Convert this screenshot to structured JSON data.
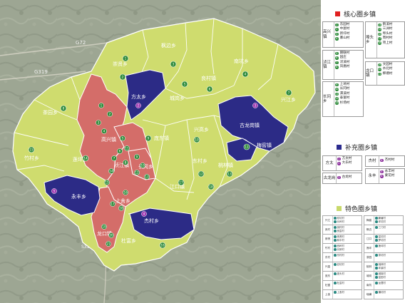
{
  "road_labels": {
    "g72": "G72",
    "g319": "G319",
    "bottom": "S311"
  },
  "regions": {
    "fengbian": "枫边乡",
    "chongxian": "崇贤乡",
    "nankeng": "南坑乡",
    "langcun": "良村镇",
    "xingjiang": "兴江乡",
    "fangtai": "方太乡",
    "chengan": "城岗乡",
    "chaka": "茶园乡",
    "zhucun": "竹村乡",
    "gulonggang": "古龙岗镇",
    "xingao": "兴高乡",
    "pangdong": "庞东镇",
    "meijiao": "梅窖镇",
    "dongcun": "东村乡",
    "xianlian": "莲坪乡",
    "changgang": "长冈乡",
    "taolin": "桃林镇",
    "gaoxing": "高兴镇",
    "shangshe": "上舍乡",
    "yongfeng": "永丰乡",
    "jiangkou": "江口镇",
    "jiangbei": "浈江镇",
    "longkou": "龙口镇",
    "dusan": "杜富乡",
    "jiecun": "杰村乡",
    "ruiheng": "瑞横乡"
  },
  "numbers": {
    "n1": "1",
    "n2": "2",
    "n3": "3",
    "n4": "4",
    "n5": "5",
    "n6": "6",
    "n7": "7",
    "n8": "8",
    "n9": "9",
    "n10": "10",
    "n11": "11",
    "n12": "12",
    "n13": "13",
    "n14": "14",
    "n15": "15",
    "n16": "16",
    "n17": "17",
    "n18": "18",
    "n19": "19",
    "n20": "20",
    "n21": "21"
  },
  "legend": {
    "core_title": "核心圈乡镇",
    "core_color": "#e02020",
    "supp_title": "补充圈乡镇",
    "supp_color": "#2b2b8e",
    "feature_title": "特色圈乡镇",
    "feature_color": "#c8d96b",
    "core_groups": [
      {
        "name": "高兴镇",
        "items": [
          "1 东园村",
          "2 中屋村",
          "3 新圩村",
          "4 寨山村"
        ]
      },
      {
        "name": "浈江镇",
        "items": [
          "5 赣联村",
          "6 园庄",
          "7 浈溪村",
          "8 凤凰村"
        ]
      },
      {
        "name": "长冈乡",
        "items": [
          "9 上坑村",
          "10 长冈村",
          "11 泗溪村",
          "12 泰富村",
          "13 杉场村"
        ]
      },
      {
        "name": "埠头乡",
        "items": [
          "14 鹤溪村",
          "15 三洲村",
          "16 埠头村",
          "17 周村村",
          "18 项上村"
        ]
      },
      {
        "name": "龙口镇",
        "items": [
          "19 文园村",
          "20 水北村",
          "21 柳塘村"
        ]
      }
    ],
    "supp_groups": [
      {
        "name": "方太",
        "items": [
          "方太村",
          "大乐村"
        ]
      },
      {
        "name": "杰村",
        "items": [
          "杰村村"
        ]
      },
      {
        "name": "古龙岗",
        "items": [
          "古龙村"
        ]
      },
      {
        "name": "永丰",
        "items": [
          "永丰村",
          "蒙花村"
        ]
      }
    ],
    "feature_cells": [
      {
        "n": "兴江",
        "v": [
          "双坑村",
          "长岭村"
        ]
      },
      {
        "n": "梅窖",
        "v": [
          "藕塘村",
          "坪坑村"
        ]
      },
      {
        "n": "良村",
        "v": [
          "良村村",
          "良富村"
        ]
      },
      {
        "n": "枫边",
        "v": [
          "三门村"
        ]
      },
      {
        "n": "崇贤",
        "v": [
          "崇贤村",
          "和平村"
        ]
      },
      {
        "n": "江口",
        "v": [
          "富坑村",
          "罗坑村"
        ]
      },
      {
        "n": "竹村",
        "v": [
          "西岭村",
          "长桥村"
        ]
      },
      {
        "n": "莲坪",
        "v": [
          "莲坪村"
        ]
      },
      {
        "n": "东村",
        "v": [
          "东村村"
        ]
      },
      {
        "n": "茶园",
        "v": [
          "茶坑村"
        ]
      },
      {
        "n": "兴高",
        "v": [
          "旧坑村"
        ]
      },
      {
        "n": "桃林",
        "v": [
          "桃林村",
          "坪溪村"
        ]
      },
      {
        "n": "庞东",
        "v": [
          "庞头村"
        ]
      },
      {
        "n": "城岗",
        "v": [
          "城岗村",
          "富田村"
        ]
      },
      {
        "n": "杜富",
        "v": [
          "杜富村"
        ]
      },
      {
        "n": "南坑",
        "v": [
          "龙潭村"
        ]
      },
      {
        "n": "上舍",
        "v": [
          "上舍村"
        ]
      },
      {
        "n": "瑞横",
        "v": [
          "横坑村"
        ]
      }
    ]
  }
}
